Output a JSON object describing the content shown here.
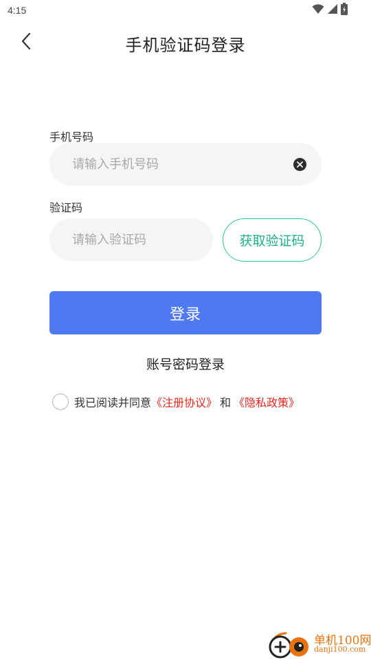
{
  "status_bar": {
    "time": "4:15",
    "icons": [
      "wifi-icon",
      "signal-icon",
      "battery-icon"
    ]
  },
  "header": {
    "title": "手机验证码登录",
    "back_icon": "chevron-left-icon"
  },
  "form": {
    "phone": {
      "label": "手机号码",
      "value": "",
      "placeholder": "请输入手机号码",
      "clear_icon": "clear-icon"
    },
    "code": {
      "label": "验证码",
      "value": "",
      "placeholder": "请输入验证码",
      "get_code_label": "获取验证码"
    },
    "login_label": "登录",
    "password_login_label": "账号密码登录"
  },
  "agreement": {
    "checked": false,
    "prefix": "我已阅读并同意",
    "terms_link": "《注册协议》",
    "and": "和",
    "privacy_link": "《隐私政策》"
  },
  "watermark": {
    "name": "单机100网",
    "url": "danji100.com"
  },
  "colors": {
    "primary_button": "#4f79f0",
    "accent_green": "#1fae8c",
    "link_red": "#e8261e",
    "input_bg": "#f5f5f5",
    "watermark_orange": "#e8720e"
  }
}
